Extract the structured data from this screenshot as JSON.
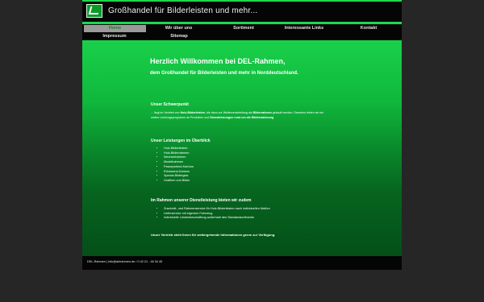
{
  "header": {
    "title": "Großhandel für Bilderleisten und mehr..."
  },
  "nav": {
    "row1": [
      "Home",
      "Wir über uns",
      "Sortiment",
      "Interessante Links",
      "Kontakt"
    ],
    "row2": [
      "Impressum",
      "Sitemap"
    ]
  },
  "main": {
    "heading": "Herzlich Willkommen bei DEL-Rahmen,",
    "subheading": "dem Großhandel  für Bilderleisten und mehr  in Norddeutschland.",
    "focus_title": "Unser Schwerpunkt",
    "focus_text_1": "... liegt im Vertrieb von ",
    "focus_bold_1": "Holz-Bilderleisten",
    "focus_text_2": ", die dann zur Weiterverarbeitung als ",
    "focus_bold_2": "Bilderrahmen",
    "focus_text_3": " gekauft werden. Daneben bieten wir ein weites Leistungsprogramm an Produkten und ",
    "focus_bold_3": "Dienstleistungen rund um die Bildeinrahmung",
    "overview_title": "Unser Leistungen im Überblick",
    "overview_items": [
      "Holz-Bilderleisten",
      "Holz-Bilderrahmen",
      "Wechselrahmen",
      "Modellrahmen",
      "Passepartout-Kartons",
      "Rückwand-Kartons",
      "Spezial-Bilderglas",
      "Grafiken und Bilder"
    ],
    "service_title": "Im Rahmen unserer Dienstleistung bieten wir zudem",
    "service_items": [
      "Zuschnitt- und Rahmenservice für Holz-Bilderleisten nach individuellen Maßen",
      "Lieferservice mit eigenem Fahrzeug",
      "individuelle Leistenbeschaffung außerhalb des Standardsortiments"
    ],
    "closing": "Unser Vertrieb steht Ihnen für weitergehende Informationen gerne zur Verfügung."
  },
  "footer": {
    "text": "DEL-Rahmen  |  info@delrahmen.de / 0 42 21 - 46 34 45"
  },
  "colors": {
    "accent": "#1bd84e",
    "background": "#262626",
    "header": "#050505"
  }
}
